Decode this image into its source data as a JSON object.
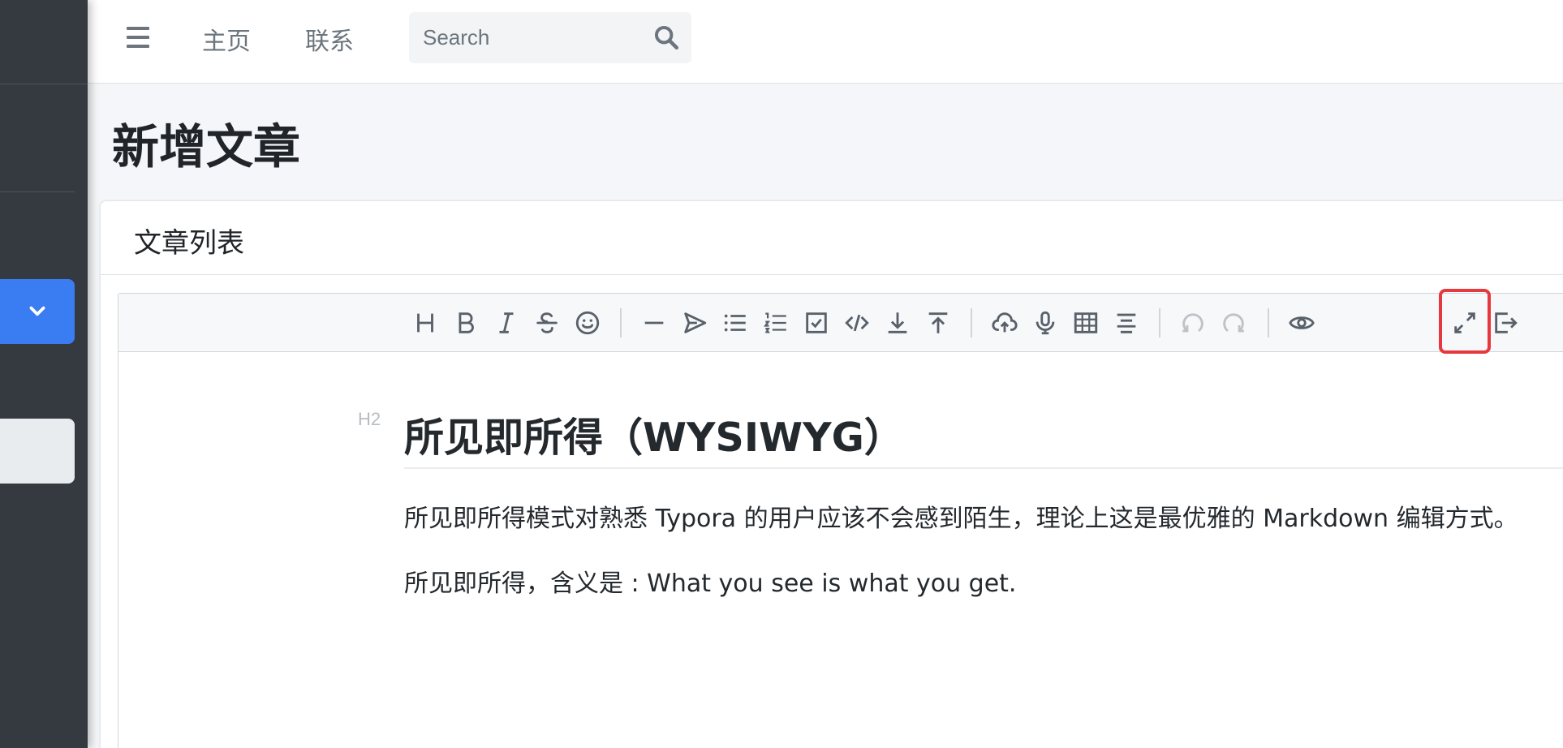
{
  "nav": {
    "links": [
      "主页",
      "联系"
    ],
    "search_placeholder": "Search"
  },
  "page": {
    "title": "新增文章"
  },
  "card": {
    "title": "文章列表"
  },
  "editor": {
    "toolbar": [
      {
        "name": "headings",
        "icon": "heading-icon"
      },
      {
        "name": "bold",
        "icon": "bold-icon"
      },
      {
        "name": "italic",
        "icon": "italic-icon"
      },
      {
        "name": "strike",
        "icon": "strikethrough-icon"
      },
      {
        "name": "emoji",
        "icon": "emoji-icon"
      },
      {
        "name": "line",
        "icon": "horizontal-rule-icon"
      },
      {
        "name": "quote",
        "icon": "quote-icon"
      },
      {
        "name": "list",
        "icon": "bullet-list-icon"
      },
      {
        "name": "ordered-list",
        "icon": "ordered-list-icon"
      },
      {
        "name": "check",
        "icon": "checklist-icon"
      },
      {
        "name": "code",
        "icon": "code-icon"
      },
      {
        "name": "inline-code",
        "icon": "download-icon"
      },
      {
        "name": "insert-before",
        "icon": "upload-top-icon"
      },
      {
        "name": "upload",
        "icon": "cloud-upload-icon"
      },
      {
        "name": "record",
        "icon": "microphone-icon"
      },
      {
        "name": "table",
        "icon": "table-icon"
      },
      {
        "name": "outline",
        "icon": "align-center-icon"
      },
      {
        "name": "undo",
        "icon": "undo-icon"
      },
      {
        "name": "redo",
        "icon": "redo-icon"
      },
      {
        "name": "preview",
        "icon": "eye-icon"
      },
      {
        "name": "fullscreen",
        "icon": "expand-icon"
      },
      {
        "name": "export",
        "icon": "export-icon"
      }
    ],
    "content": {
      "heading_marker": "H2",
      "heading": "所见即所得（WYSIWYG）",
      "paragraph1": "所见即所得模式对熟悉 Typora 的用户应该不会感到陌生，理论上这是最优雅的 Markdown 编辑方式。",
      "paragraph2": "所见即所得，含义是 : What you see is what you get."
    }
  },
  "colors": {
    "sidebar": "#343a40",
    "accent": "#3a7cf2",
    "highlight": "#e5393e"
  }
}
